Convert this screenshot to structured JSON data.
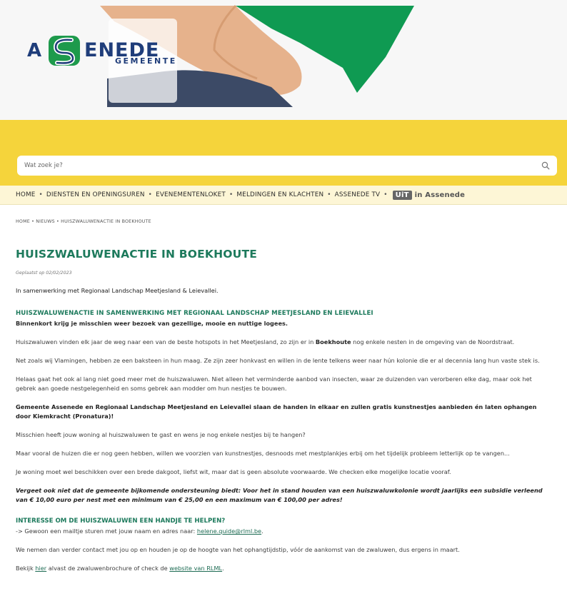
{
  "logo": {
    "small_text": "GEMEENTE",
    "letter_a": "A",
    "rest": "ENEDE"
  },
  "search": {
    "placeholder": "Wat zoek je?"
  },
  "nav": {
    "items": [
      "HOME",
      "DIENSTEN EN OPENINGSUREN",
      "EVENEMENTENLOKET",
      "MELDINGEN EN KLACHTEN",
      "ASSENEDE TV"
    ],
    "uit_box": "UiT",
    "uit_label": "in Assenede"
  },
  "breadcrumb": {
    "home": "HOME",
    "news": "NIEUWS",
    "current": "HUISZWALUWENACTIE IN BOEKHOUTE"
  },
  "article": {
    "title": "HUISZWALUWENACTIE IN BOEKHOUTE",
    "posted": "Geplaatst op 02/02/2023",
    "intro": "In samenwerking met Regionaal Landschap Meetjesland & Leievallei.",
    "h2_1": "HUISZWALUWENACTIE IN SAMENWERKING MET REGIONAAL LANDSCHAP MEETJESLAND EN LEIEVALLEI",
    "lead": "Binnenkort krijg je misschien weer bezoek van gezellige, mooie en nuttige logees.",
    "p1_before": "Huiszwaluwen vinden elk jaar de weg naar een van de beste hotspots in het Meetjesland, zo zijn er in ",
    "p1_bold": "Boekhoute",
    "p1_after": " nog enkele nesten in de omgeving van de Noordstraat.",
    "p2": "Net zoals wij Vlamingen, hebben ze een baksteen in hun maag. Ze zijn zeer honkvast en willen in de lente telkens weer naar hún kolonie die er al decennia lang hun vaste stek is.",
    "p3": "Helaas gaat het ook al lang niet goed meer met de huiszwaluwen. Niet alleen het verminderde aanbod van insecten, waar ze duizenden van verorberen elke dag, maar ook het gebrek aan goede nestgelegenheid en soms gebrek aan modder om hun nestjes te bouwen.",
    "p4": "Gemeente Assenede en Regionaal Landschap Meetjesland en Leievallei slaan de handen in elkaar en zullen gratis kunstnestjes aanbieden én laten ophangen door Kiemkracht (Pronatura)!",
    "p5": "Misschien heeft jouw woning al huiszwaluwen te gast en wens je nog enkele nestjes bij te hangen?",
    "p6": "Maar vooral de huizen die er nog geen hebben, willen we voorzien van kunstnestjes, desnoods met mestplankjes erbij om het tijdelijk probleem letterlijk op te vangen...",
    "p7": "Je woning moet wel beschikken over een brede dakgoot, liefst wit, maar dat is geen absolute voorwaarde. We checken elke mogelijke locatie vooraf.",
    "p8": "Vergeet  ook niet dat de gemeente bijkomende ondersteuning biedt:  Voor het in stand houden van een huiszwaluwkolonie wordt jaarlijks een subsidie verleend van € 10,00 euro per nest met een minimum van € 25,00 en een maximum van € 100,00 per adres!",
    "h2_2": "INTERESSE OM DE HUISZWALUWEN EEN HANDJE TE HELPEN?",
    "p9_before": "-> Gewoon een mailtje sturen met jouw naam en adres naar: ",
    "p9_link": "helene.quide@rlml.be",
    "p9_after": ".",
    "p10": "We nemen dan verder contact met jou op en houden je op de hoogte van het ophangtijdstip, vóór de aankomst van de zwaluwen, dus ergens in maart.",
    "p11_before": "Bekijk ",
    "p11_link1": "hier",
    "p11_mid": " alvast de zwaluwenbrochure of check de ",
    "p11_link2": "website van RLML",
    "p11_after": "."
  },
  "colors": {
    "brand_green": "#1d7a5c",
    "brand_yellow": "#f5d43b",
    "logo_blue": "#1f3d7a"
  }
}
